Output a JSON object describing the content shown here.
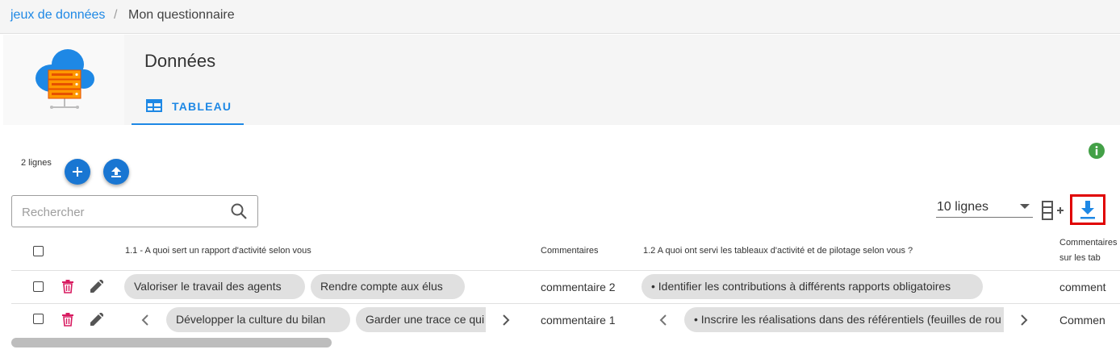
{
  "breadcrumb": {
    "root": "jeux de données",
    "separator": "/",
    "current": "Mon questionnaire"
  },
  "header": {
    "title": "Données",
    "tab_label": "TABLEAU"
  },
  "toolbar": {
    "rows_count": "2 lignes",
    "search_placeholder": "Rechercher",
    "rows_per_page": "10 lignes"
  },
  "table": {
    "columns": [
      "1.1 - A quoi sert un rapport d'activité selon vous",
      "Commentaires",
      "1.2 A quoi ont servi les tableaux d'activité et de pilotage selon vous ?",
      "Commentaires",
      "sur les tab"
    ],
    "rows": [
      {
        "q11": [
          "Valoriser le travail des agents",
          "Rendre compte aux élus"
        ],
        "comment1": "commentaire 2",
        "q12": [
          "• Identifier les contributions à différents rapports obligatoires"
        ],
        "comment2": "comment"
      },
      {
        "q11": [
          "Développer la culture du bilan",
          "Garder une trace ce qui"
        ],
        "comment1": "commentaire 1",
        "q12": [
          "• Inscrire les réalisations dans des référentiels (feuilles de rou"
        ],
        "comment2": "Commen"
      }
    ]
  },
  "colors": {
    "accent": "#1e88e5",
    "fab": "#1976d2",
    "delete": "#d81b60",
    "info": "#43a047",
    "highlight": "#e00000"
  }
}
